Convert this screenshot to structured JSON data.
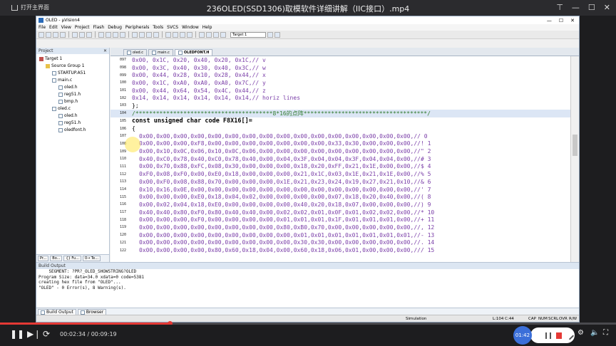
{
  "player": {
    "open_main": "打开主界面",
    "title": "236OLED(SSD1306)取模软件详细讲解（IIC接口）.mp4",
    "current_time": "00:02:34",
    "total_time": "00:09:19",
    "time_separator": " / ",
    "badge_time": "01:42",
    "progress": 0.276
  },
  "uv": {
    "title": "OLED - µVision4",
    "menu": [
      "File",
      "Edit",
      "View",
      "Project",
      "Flash",
      "Debug",
      "Peripherals",
      "Tools",
      "SVCS",
      "Window",
      "Help"
    ],
    "target_select": "Target 1"
  },
  "project": {
    "header": "Project",
    "tree": [
      {
        "label": "Target 1",
        "level": 0,
        "type": "target"
      },
      {
        "label": "Source Group 1",
        "level": 1,
        "type": "folder"
      },
      {
        "label": "STARTUP.A51",
        "level": 2,
        "type": "file"
      },
      {
        "label": "main.c",
        "level": 2,
        "type": "file"
      },
      {
        "label": "oled.h",
        "level": 3,
        "type": "file"
      },
      {
        "label": "reg51.h",
        "level": 3,
        "type": "file"
      },
      {
        "label": "bmp.h",
        "level": 3,
        "type": "file"
      },
      {
        "label": "oled.c",
        "level": 2,
        "type": "file"
      },
      {
        "label": "oled.h",
        "level": 3,
        "type": "file"
      },
      {
        "label": "reg51.h",
        "level": 3,
        "type": "file"
      },
      {
        "label": "oledfont.h",
        "level": 3,
        "type": "file"
      }
    ],
    "tabs": [
      "Pr...",
      "Bo...",
      "{} Fu...",
      "0→ Te..."
    ]
  },
  "editor": {
    "tabs": [
      {
        "label": "oled.c",
        "active": false
      },
      {
        "label": "main.c",
        "active": false
      },
      {
        "label": "OLEDFONT.H",
        "active": true
      }
    ],
    "lines": [
      {
        "n": "097",
        "text": "0x00, 0x1C, 0x20, 0x40, 0x20, 0x1C,// v",
        "cls": "data"
      },
      {
        "n": "098",
        "text": "0x00, 0x3C, 0x40, 0x30, 0x40, 0x3C,// w",
        "cls": "data"
      },
      {
        "n": "099",
        "text": "0x00, 0x44, 0x28, 0x10, 0x28, 0x44,// x",
        "cls": "data"
      },
      {
        "n": "100",
        "text": "0x00, 0x1C, 0xA0, 0xA0, 0xA0, 0x7C,// y",
        "cls": "data"
      },
      {
        "n": "101",
        "text": "0x00, 0x44, 0x64, 0x54, 0x4C, 0x44,// z",
        "cls": "data"
      },
      {
        "n": "102",
        "text": "0x14, 0x14, 0x14, 0x14, 0x14, 0x14,// horiz lines",
        "cls": "data"
      },
      {
        "n": "103",
        "text": "};",
        "cls": "plain"
      },
      {
        "n": "104",
        "text": "/****************************************8*16的点阵************************************/",
        "cls": "cmt",
        "hl": true
      },
      {
        "n": "105",
        "text": "const unsigned char code F8X16[]=",
        "cls": "kw"
      },
      {
        "n": "106",
        "text": "{",
        "cls": "plain"
      },
      {
        "n": "107",
        "text": "0x00,0x00,0x00,0x00,0x00,0x00,0x00,0x00,0x00,0x00,0x00,0x00,0x00,0x00,0x00,0x00,// 0",
        "cls": "data indent"
      },
      {
        "n": "108",
        "text": "0x00,0x00,0x00,0xF8,0x00,0x00,0x00,0x00,0x00,0x00,0x00,0x33,0x30,0x00,0x00,0x00,//! 1",
        "cls": "data indent"
      },
      {
        "n": "109",
        "text": "0x00,0x10,0x0C,0x06,0x10,0x0C,0x06,0x00,0x00,0x00,0x00,0x00,0x00,0x00,0x00,0x00,//\" 2",
        "cls": "data indent"
      },
      {
        "n": "110",
        "text": "0x40,0xC0,0x78,0x40,0xC0,0x78,0x40,0x00,0x04,0x3F,0x04,0x04,0x3F,0x04,0x04,0x00,//# 3",
        "cls": "data indent"
      },
      {
        "n": "111",
        "text": "0x00,0x70,0x88,0xFC,0x08,0x30,0x00,0x00,0x00,0x18,0x20,0xFF,0x21,0x1E,0x00,0x00,//$ 4",
        "cls": "data indent"
      },
      {
        "n": "112",
        "text": "0xF0,0x08,0xF0,0x00,0xE0,0x18,0x00,0x00,0x00,0x21,0x1C,0x03,0x1E,0x21,0x1E,0x00,//% 5",
        "cls": "data indent"
      },
      {
        "n": "113",
        "text": "0x00,0xF0,0x08,0x88,0x70,0x00,0x00,0x00,0x1E,0x21,0x23,0x24,0x19,0x27,0x21,0x10,//& 6",
        "cls": "data indent"
      },
      {
        "n": "114",
        "text": "0x10,0x16,0x0E,0x00,0x00,0x00,0x00,0x00,0x00,0x00,0x00,0x00,0x00,0x00,0x00,0x00,//' 7",
        "cls": "data indent"
      },
      {
        "n": "115",
        "text": "0x00,0x00,0x00,0xE0,0x18,0x04,0x02,0x00,0x00,0x00,0x00,0x07,0x18,0x20,0x40,0x00,//( 8",
        "cls": "data indent"
      },
      {
        "n": "116",
        "text": "0x00,0x02,0x04,0x18,0xE0,0x00,0x00,0x00,0x00,0x40,0x20,0x18,0x07,0x00,0x00,0x00,//) 9",
        "cls": "data indent"
      },
      {
        "n": "117",
        "text": "0x40,0x40,0x80,0xF0,0x80,0x40,0x40,0x00,0x02,0x02,0x01,0x0F,0x01,0x02,0x02,0x00,//* 10",
        "cls": "data indent"
      },
      {
        "n": "118",
        "text": "0x00,0x00,0x00,0xF0,0x00,0x00,0x00,0x00,0x01,0x01,0x01,0x1F,0x01,0x01,0x01,0x00,//+ 11",
        "cls": "data indent"
      },
      {
        "n": "119",
        "text": "0x00,0x00,0x00,0x00,0x00,0x00,0x00,0x00,0x80,0xB0,0x70,0x00,0x00,0x00,0x00,0x00,//, 12",
        "cls": "data indent"
      },
      {
        "n": "120",
        "text": "0x00,0x00,0x00,0x00,0x00,0x00,0x00,0x00,0x00,0x01,0x01,0x01,0x01,0x01,0x01,0x01,//- 13",
        "cls": "data indent"
      },
      {
        "n": "121",
        "text": "0x00,0x00,0x00,0x00,0x00,0x00,0x00,0x00,0x00,0x30,0x30,0x00,0x00,0x00,0x00,0x00,//. 14",
        "cls": "data indent"
      },
      {
        "n": "122",
        "text": "0x00,0x00,0x00,0x00,0x80,0x60,0x18,0x04,0x00,0x60,0x18,0x06,0x01,0x00,0x00,0x00,/// 15",
        "cls": "data indent"
      }
    ]
  },
  "build": {
    "header": "Build Output",
    "lines": [
      "    SEGMENT: ?PR?_OLED_SHOWSTRING?OLED",
      "Program Size: data=34.0 xdata=0 code=5381",
      "creating hex file from \"OLED\"...",
      "\"OLED\" - 0 Error(s), 8 Warning(s)."
    ],
    "tabs": [
      "Build Output",
      "Browser"
    ]
  },
  "status": {
    "mode": "Simulation",
    "position": "L:104 C:44",
    "caps": "CAP",
    "num": "NUM",
    "scrl": "SCRL",
    "ovr": "OVR",
    "rw": "R/W"
  }
}
